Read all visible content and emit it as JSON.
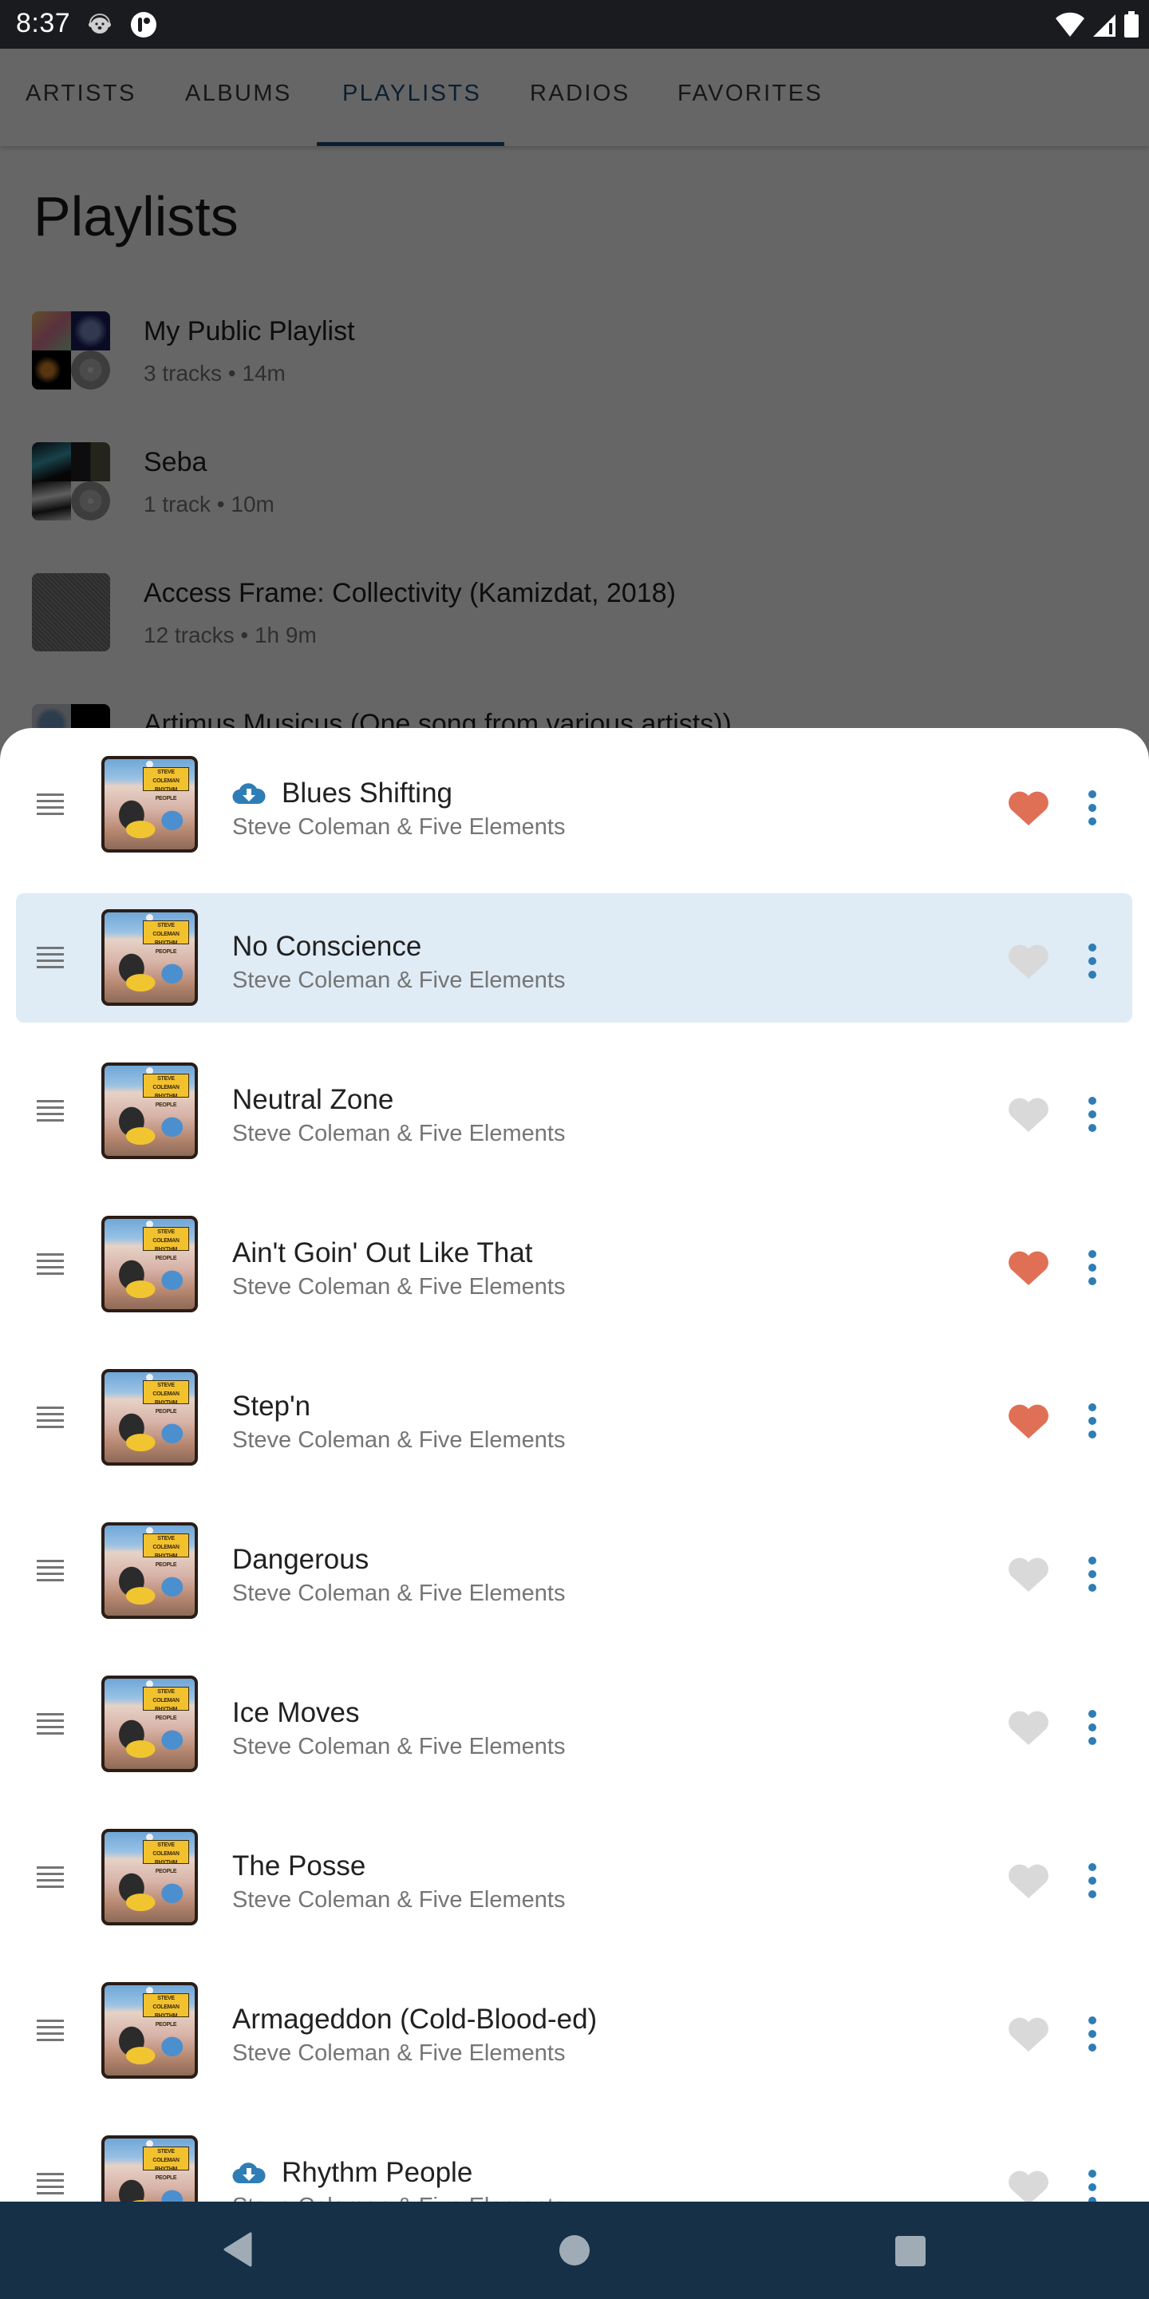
{
  "status_bar": {
    "time": "8:37",
    "left_icons": [
      "otter-headphones-icon",
      "circle-app-icon"
    ],
    "right_icons": [
      "wifi-icon",
      "cell-signal-icon",
      "battery-icon"
    ]
  },
  "tabs": [
    {
      "label": "ARTISTS",
      "active": false
    },
    {
      "label": "ALBUMS",
      "active": false
    },
    {
      "label": "PLAYLISTS",
      "active": true
    },
    {
      "label": "RADIOS",
      "active": false
    },
    {
      "label": "FAVORITES",
      "active": false
    }
  ],
  "page": {
    "title": "Playlists",
    "playlists": [
      {
        "title": "My Public Playlist",
        "subtitle": "3 tracks • 14m"
      },
      {
        "title": "Seba",
        "subtitle": "1 track • 10m"
      },
      {
        "title": "Access Frame: Collectivity (Kamizdat, 2018)",
        "subtitle": "12 tracks • 1h 9m"
      },
      {
        "title": "Artimus Musicus (One song from various artists))",
        "subtitle": ""
      }
    ]
  },
  "sheet": {
    "album_cover_text": [
      "STEVE COLEMAN",
      "RHYTHM PEOPLE"
    ],
    "tracks": [
      {
        "title": "Blues Shifting",
        "artist": "Steve Coleman & Five Elements",
        "downloaded": true,
        "favorite": true,
        "selected": false
      },
      {
        "title": "No Conscience",
        "artist": "Steve Coleman & Five Elements",
        "downloaded": false,
        "favorite": false,
        "selected": true
      },
      {
        "title": "Neutral Zone",
        "artist": "Steve Coleman & Five Elements",
        "downloaded": false,
        "favorite": false,
        "selected": false
      },
      {
        "title": "Ain't Goin' Out Like That",
        "artist": "Steve Coleman & Five Elements",
        "downloaded": false,
        "favorite": true,
        "selected": false
      },
      {
        "title": "Step'n",
        "artist": "Steve Coleman & Five Elements",
        "downloaded": false,
        "favorite": true,
        "selected": false
      },
      {
        "title": "Dangerous",
        "artist": "Steve Coleman & Five Elements",
        "downloaded": false,
        "favorite": false,
        "selected": false
      },
      {
        "title": "Ice Moves",
        "artist": "Steve Coleman & Five Elements",
        "downloaded": false,
        "favorite": false,
        "selected": false
      },
      {
        "title": "The Posse",
        "artist": "Steve Coleman & Five Elements",
        "downloaded": false,
        "favorite": false,
        "selected": false
      },
      {
        "title": "Armageddon (Cold-Blood-ed)",
        "artist": "Steve Coleman & Five Elements",
        "downloaded": false,
        "favorite": false,
        "selected": false
      },
      {
        "title": "Rhythm People",
        "artist": "Steve Coleman & Five Elements",
        "downloaded": true,
        "favorite": false,
        "selected": false
      }
    ]
  },
  "colors": {
    "accent": "#1f4f7a",
    "favorite_on": "#e07055",
    "favorite_off": "#d9d9d9",
    "more_dots": "#2f7db5",
    "download": "#2f7db5",
    "selected_row": "#dfebf5",
    "nav_bar": "#153047",
    "status_bar": "#1a1b1e"
  },
  "nav_bar": {
    "buttons": [
      "back-icon",
      "home-icon",
      "recents-icon"
    ]
  }
}
